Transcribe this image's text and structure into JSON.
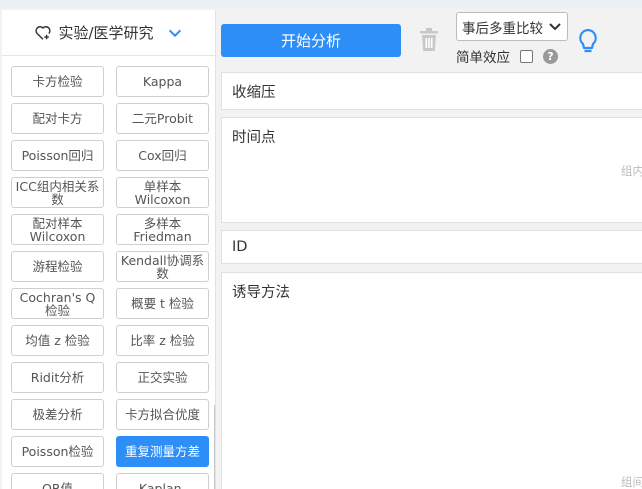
{
  "sidebar": {
    "category_label": "实验/医学研究",
    "methods": [
      {
        "label": "卡方检验",
        "active": false
      },
      {
        "label": "Kappa",
        "active": false
      },
      {
        "label": "配对卡方",
        "active": false
      },
      {
        "label": "二元Probit",
        "active": false
      },
      {
        "label": "Poisson回归",
        "active": false
      },
      {
        "label": "Cox回归",
        "active": false
      },
      {
        "label": "ICC组内相关系数",
        "active": false
      },
      {
        "label": "单样本Wilcoxon",
        "active": false
      },
      {
        "label": "配对样本Wilcoxon",
        "active": false
      },
      {
        "label": "多样本Friedman",
        "active": false
      },
      {
        "label": "游程检验",
        "active": false
      },
      {
        "label": "Kendall协调系数",
        "active": false
      },
      {
        "label": "Cochran's Q检验",
        "active": false
      },
      {
        "label": "概要 t 检验",
        "active": false
      },
      {
        "label": "均值 z 检验",
        "active": false
      },
      {
        "label": "比率 z 检验",
        "active": false
      },
      {
        "label": "Ridit分析",
        "active": false
      },
      {
        "label": "正交实验",
        "active": false
      },
      {
        "label": "极差分析",
        "active": false
      },
      {
        "label": "卡方拟合优度",
        "active": false
      },
      {
        "label": "Poisson检验",
        "active": false
      },
      {
        "label": "重复测量方差",
        "active": true
      },
      {
        "label": "OR值",
        "active": false
      },
      {
        "label": "Kaplan-",
        "active": false
      }
    ]
  },
  "toolbar": {
    "start_label": "开始分析",
    "posthoc_select": "事后多重比较",
    "effect_label": "简单效应",
    "help_label": "?"
  },
  "fields": [
    {
      "label": "收缩压",
      "hint": ""
    },
    {
      "label": "时间点",
      "hint": "组内"
    },
    {
      "label": "ID",
      "hint": ""
    },
    {
      "label": "诱导方法",
      "hint": "组间"
    }
  ],
  "colors": {
    "primary": "#2e8ef7",
    "icon_blue": "#2e8ef7",
    "trash_gray": "#c8c8c8"
  },
  "icons": [
    "heart-plus-icon",
    "chevron-down-icon",
    "trash-icon",
    "dropdown-arrow-icon",
    "help-icon",
    "lightbulb-icon"
  ]
}
